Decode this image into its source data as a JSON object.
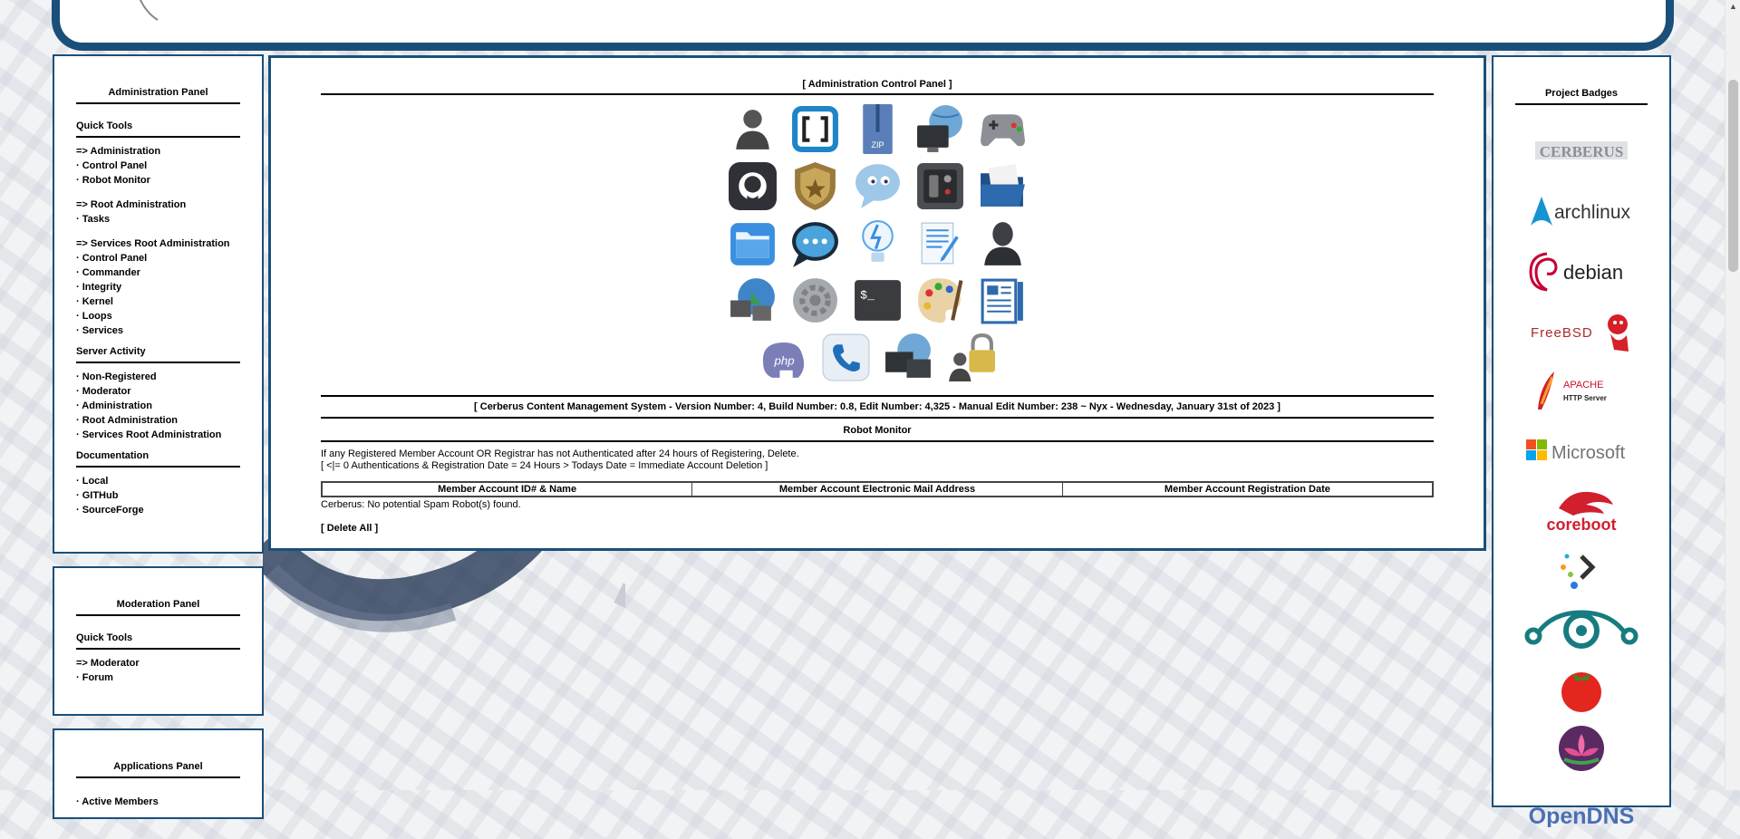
{
  "admin_panel": {
    "title": "Administration Panel",
    "sections": [
      {
        "title": "Quick Tools",
        "items": [
          "=> Administration",
          "· Control Panel",
          "· Robot Monitor",
          "=> Root Administration",
          "· Tasks",
          "=> Services Root Administration",
          "· Control Panel",
          "· Commander",
          "· Integrity",
          "· Kernel",
          "· Loops",
          "· Services"
        ]
      },
      {
        "title": "Server Activity",
        "items": [
          "· Non-Registered",
          "· Moderator",
          "· Administration",
          "· Root Administration",
          "· Services Root Administration"
        ]
      },
      {
        "title": "Documentation",
        "items": [
          "· Local",
          "· GITHub",
          "· SourceForge"
        ]
      }
    ]
  },
  "moderation_panel": {
    "title": "Moderation Panel",
    "sections": [
      {
        "title": "Quick Tools",
        "items": [
          "=> Moderator",
          "· Forum"
        ]
      }
    ]
  },
  "applications_panel": {
    "title": "Applications Panel",
    "items": [
      "· Active Members"
    ]
  },
  "main": {
    "title": "[ Administration Control Panel ]",
    "icon_rows": [
      [
        "user-icon",
        "brackets-editor-icon",
        "zip-archive-icon",
        "network-display-icon",
        "gamepad-icon"
      ],
      [
        "github-icon",
        "security-badge-icon",
        "chat-bubble-icon",
        "power-panel-icon",
        "open-folder-icon"
      ],
      [
        "folder-icon",
        "messages-icon",
        "lightbulb-icon",
        "text-editor-icon",
        "user-silhouette-icon"
      ],
      [
        "network-globe-icon",
        "settings-gear-icon",
        "terminal-icon",
        "paint-palette-icon",
        "news-document-icon"
      ],
      [
        "php-icon",
        "phone-icon",
        "remote-desktop-icon",
        "user-lock-icon"
      ]
    ],
    "cms_line": "[ Cerberus Content Management System - Version Number: 4, Build Number: 0.8, Edit Number: 4,325 - Manual Edit Number: 238 ~ Nyx - Wednesday, January 31st of 2023 ]",
    "robot_title": "Robot Monitor",
    "info_line1": "If any Registered Member Account OR Registrar has not Authenticated after 24 hours of Registering, Delete.",
    "info_line2": "[ <|= 0 Authentications & Registration Date = 24 Hours > Todays Date = Immediate Account Deletion ]",
    "table_headers": [
      "Member Account ID# & Name",
      "Member Account Electronic Mail Address",
      "Member Account Registration Date"
    ],
    "result": "Cerberus: No potential Spam Robot(s) found.",
    "delete_label": "[ Delete All ]"
  },
  "badges": {
    "title": "Project Badges",
    "items": [
      "CERBERUS",
      "archlinux",
      "debian",
      "FreeBSD",
      "APACHE",
      "HTTP Server",
      "Microsoft",
      "coreboot",
      "OpenDNS"
    ]
  },
  "colors": {
    "frame": "#1a4f7a",
    "background": "#f2f3f5"
  }
}
